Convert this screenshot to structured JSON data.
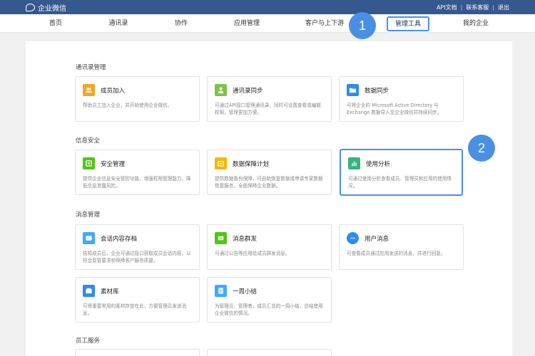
{
  "topbar": {
    "logo_text": "企业微信",
    "links": [
      "API文档",
      "联系客服",
      "退出"
    ]
  },
  "nav": {
    "items": [
      "首页",
      "通讯录",
      "协作",
      "应用管理",
      "客户与上下游",
      "管理工具",
      "我的企业"
    ],
    "active_index": 5
  },
  "badges": [
    "1",
    "2"
  ],
  "sections": [
    {
      "title": "通讯录管理",
      "cards": [
        {
          "title": "成员加入",
          "desc": "帮助员工加入企业，并开始使用企业微信。",
          "icon": "users-icon",
          "color": "#f5a623"
        },
        {
          "title": "通讯录同步",
          "desc": "可通过API接口管理通讯录，同时可设置查看或编辑权限，管理更加方便。",
          "icon": "person-sync-icon",
          "color": "#7cc545"
        },
        {
          "title": "数据同步",
          "desc": "可将企业的 Microsoft Active Directory 与 Exchange 数据导入至企业微信并持续同步。",
          "icon": "folder-icon",
          "color": "#2d8cf0"
        }
      ]
    },
    {
      "title": "信息安全",
      "cards": [
        {
          "title": "安全管理",
          "desc": "提供企业信息安全管控功能，增强权限管理能力，降低信息泄露风险。",
          "icon": "security-icon",
          "color": "#52c41a"
        },
        {
          "title": "数据保障计划",
          "desc": "提供数据备份保障，可自助恢复数据或申请专家数据恢复服务，全面保障企业数据。",
          "icon": "data-backup-icon",
          "color": "#f5b700"
        },
        {
          "title": "使用分析",
          "desc": "可通过使用分析查看成员、管理员和应用的使用情况。",
          "icon": "bar-chart-icon",
          "color": "#36b37e"
        }
      ]
    },
    {
      "title": "消息管理",
      "cards": [
        {
          "title": "会话内容存档",
          "desc": "告知成员后，企业可通过接口获取成员会话内容，以符合监管要求和保障客户服务质量。",
          "icon": "archive-icon",
          "color": "#40a9ff"
        },
        {
          "title": "消息群发",
          "desc": "可通过公告等应用给成员群发消息。",
          "icon": "broadcast-icon",
          "color": "#52c41a"
        },
        {
          "title": "用户消息",
          "desc": "可查看成员通过应用发送的消息，并进行回复。",
          "icon": "chat-icon",
          "color": "#2d8cf0"
        },
        {
          "title": "素材库",
          "desc": "可将重要常用的素材存放在此，方便管理员发送消息。",
          "icon": "material-library-icon",
          "color": "#2d8cf0"
        },
        {
          "title": "一周小结",
          "desc": "为管理员、管理者、成员汇总的一周小结，总结使用企业微信的情况。",
          "icon": "weekly-summary-icon",
          "color": "#40a9ff"
        }
      ]
    },
    {
      "title": "员工服务",
      "cards": []
    }
  ]
}
